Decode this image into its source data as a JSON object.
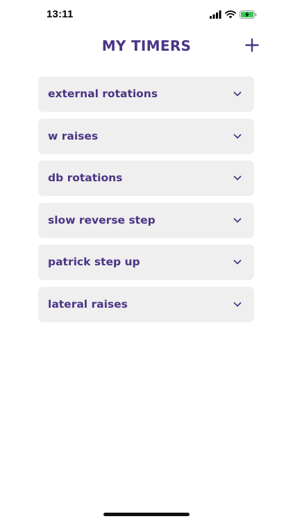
{
  "status_bar": {
    "time": "13:11",
    "icons": [
      "signal-icon",
      "wifi-icon",
      "battery-charging-icon"
    ],
    "battery_color": "#34c759"
  },
  "header": {
    "title": "MY TIMERS",
    "add_icon": "plus-icon"
  },
  "timers": [
    {
      "name": "external rotations"
    },
    {
      "name": "w raises"
    },
    {
      "name": "db rotations"
    },
    {
      "name": "slow reverse step"
    },
    {
      "name": "patrick step up"
    },
    {
      "name": "lateral raises"
    }
  ],
  "colors": {
    "accent": "#4a3585",
    "card_background": "#efefef",
    "background": "#ffffff"
  }
}
